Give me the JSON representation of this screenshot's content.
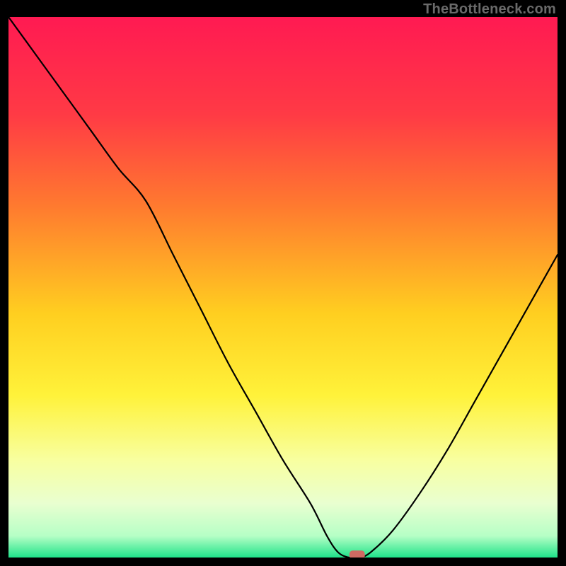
{
  "watermark": "TheBottleneck.com",
  "chart_data": {
    "type": "line",
    "title": "",
    "xlabel": "",
    "ylabel": "",
    "xlim": [
      0,
      100
    ],
    "ylim": [
      0,
      100
    ],
    "grid": false,
    "legend": false,
    "background_gradient": {
      "stops": [
        {
          "offset": 0.0,
          "color": "#ff1a52"
        },
        {
          "offset": 0.18,
          "color": "#ff3a45"
        },
        {
          "offset": 0.35,
          "color": "#ff7a2f"
        },
        {
          "offset": 0.55,
          "color": "#ffcf20"
        },
        {
          "offset": 0.7,
          "color": "#fff23a"
        },
        {
          "offset": 0.82,
          "color": "#f8ffa0"
        },
        {
          "offset": 0.9,
          "color": "#e9ffd0"
        },
        {
          "offset": 0.96,
          "color": "#b6ffc6"
        },
        {
          "offset": 1.0,
          "color": "#1fe38a"
        }
      ]
    },
    "series": [
      {
        "name": "bottleneck-curve",
        "x": [
          0,
          5,
          10,
          15,
          20,
          25,
          30,
          35,
          40,
          45,
          50,
          55,
          58,
          60,
          62,
          64,
          66,
          70,
          75,
          80,
          85,
          90,
          95,
          100
        ],
        "y": [
          100,
          93,
          86,
          79,
          72,
          66,
          56,
          46,
          36,
          27,
          18,
          10,
          4,
          1,
          0,
          0,
          1,
          5,
          12,
          20,
          29,
          38,
          47,
          56
        ]
      }
    ],
    "marker": {
      "name": "minimum-marker",
      "x": 63.5,
      "y": 0.5,
      "color": "#cf6a63"
    }
  }
}
